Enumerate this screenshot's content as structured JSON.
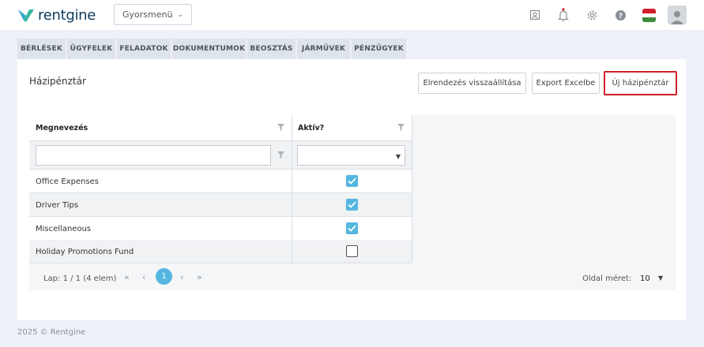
{
  "app": {
    "logo_text": "rentgine",
    "brand_color": "#0e3a5c",
    "accent_color": "#55b6e0"
  },
  "header": {
    "quickmenu_label": "Gyorsmenü",
    "icons": [
      "contact-card-icon",
      "bell-icon",
      "gear-icon",
      "help-icon",
      "hungarian-flag-icon",
      "user-avatar-icon"
    ]
  },
  "tabs": [
    "BÉRLÉSEK",
    "ÜGYFELEK",
    "FELADATOK",
    "DOKUMENTUMOK",
    "BEOSZTÁS",
    "JÁRMŰVEK",
    "PÉNZÜGYEK"
  ],
  "page": {
    "title": "Házipénztár",
    "buttons": {
      "reset_layout": "Elrendezés visszaállítása",
      "export": "Export Excelbe",
      "new": "Új házipénztár"
    }
  },
  "grid": {
    "columns": [
      "Megnevezés",
      "Aktív?"
    ],
    "filter_placeholder": "",
    "rows": [
      {
        "name": "Office Expenses",
        "active": true
      },
      {
        "name": "Driver Tips",
        "active": true
      },
      {
        "name": "Miscellaneous",
        "active": true
      },
      {
        "name": "Holiday Promotions Fund",
        "active": false
      }
    ]
  },
  "pager": {
    "info": "Lap: 1 / 1 (4 elem)",
    "current_page": "1",
    "page_size_label": "Oldal méret:",
    "page_size": "10"
  },
  "footer": {
    "text": "2025 © Rentgine"
  }
}
